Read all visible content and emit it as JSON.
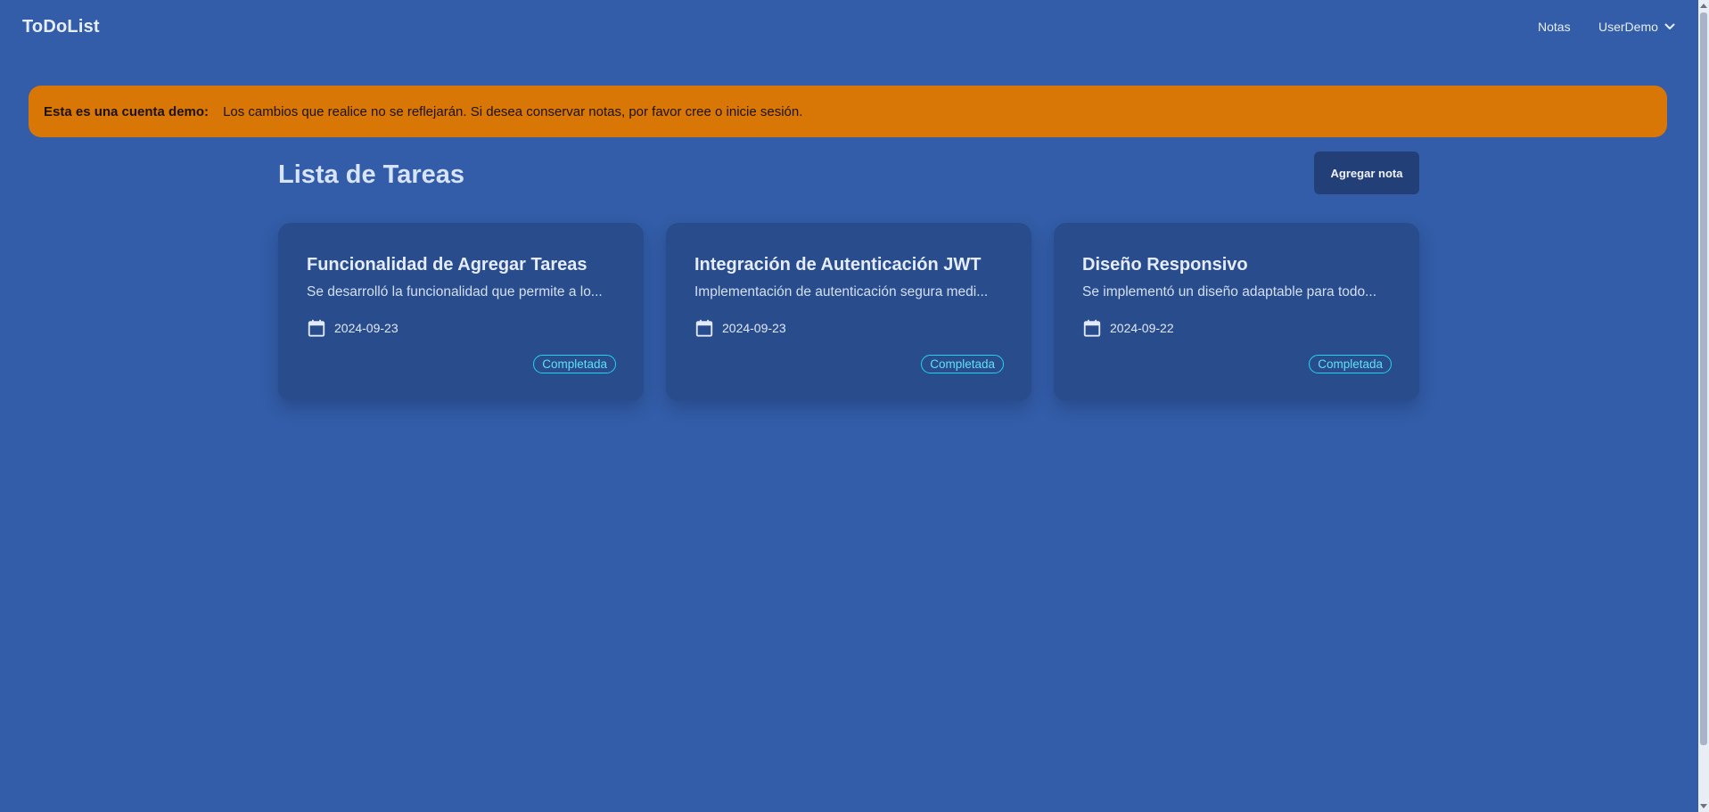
{
  "nav": {
    "brand": "ToDoList",
    "notes_link": "Notas",
    "user_menu": "UserDemo"
  },
  "banner": {
    "strong": "Esta es una cuenta demo:",
    "text": "Los cambios que realice no se reflejarán. Si desea conservar notas, por favor cree o inicie sesión.",
    "color": "#d97706"
  },
  "main": {
    "title": "Lista de Tareas",
    "add_button": "Agregar nota"
  },
  "tasks": [
    {
      "title": "Funcionalidad de Agregar Tareas",
      "description": "Se desarrolló la funcionalidad que permite a lo...",
      "date": "2024-09-23",
      "status": "Completada"
    },
    {
      "title": "Integración de Autenticación JWT",
      "description": "Implementación de autenticación segura medi...",
      "date": "2024-09-23",
      "status": "Completada"
    },
    {
      "title": "Diseño Responsivo",
      "description": "Se implementó un diseño adaptable para todo...",
      "date": "2024-09-22",
      "status": "Completada"
    }
  ],
  "icons": {
    "date": "calendar-icon",
    "user_menu": "chevron-down-icon"
  },
  "colors": {
    "background": "#335da8",
    "card": "#294d8c",
    "badge": "#22d3ee",
    "button": "#233f78"
  }
}
